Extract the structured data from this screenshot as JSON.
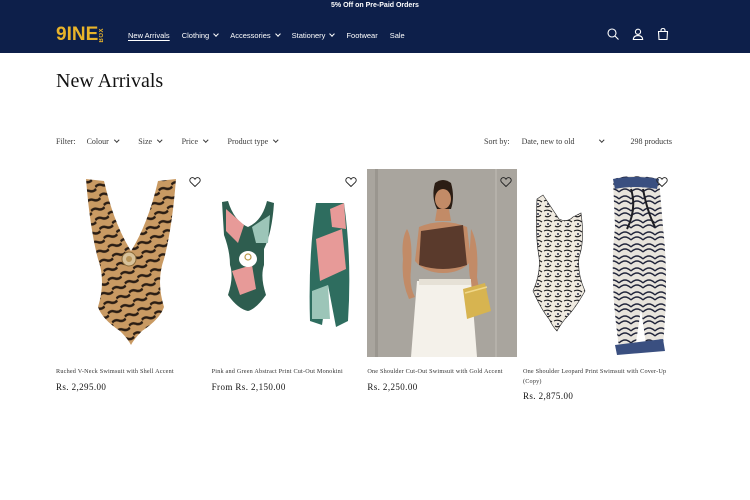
{
  "announcement": "5% Off on Pre-Paid Orders",
  "header": {
    "logo_main": "9INE",
    "logo_sub": "BOX",
    "nav": [
      {
        "label": "New Arrivals",
        "dropdown": false,
        "active": true
      },
      {
        "label": "Clothing",
        "dropdown": true
      },
      {
        "label": "Accessories",
        "dropdown": true
      },
      {
        "label": "Stationery",
        "dropdown": true
      },
      {
        "label": "Footwear",
        "dropdown": false
      },
      {
        "label": "Sale",
        "dropdown": false
      }
    ],
    "icons": [
      "search-icon",
      "account-icon",
      "cart-icon"
    ]
  },
  "page_title": "New Arrivals",
  "filters": {
    "label": "Filter:",
    "items": [
      "Colour",
      "Size",
      "Price",
      "Product type"
    ]
  },
  "sort": {
    "label": "Sort by:",
    "value": "Date, new to old"
  },
  "product_count": "298 products",
  "products": [
    {
      "title": "Ruched V-Neck Swimsuit with Shell Accent",
      "price": "Rs. 2,295.00"
    },
    {
      "title": "Pink and Green Abstract Print Cut-Out Monokini",
      "price": "From Rs. 2,150.00"
    },
    {
      "title": "One Shoulder Cut-Out Swimsuit with Gold Accent",
      "price": "Rs. 2,250.00"
    },
    {
      "title": "One Shoulder Leopard Print Swimsuit with Cover-Up (Copy)",
      "price": "Rs. 2,875.00"
    }
  ],
  "colors": {
    "header_bg": "#0d1f4a",
    "logo": "#e8b32a",
    "text": "#121212"
  }
}
